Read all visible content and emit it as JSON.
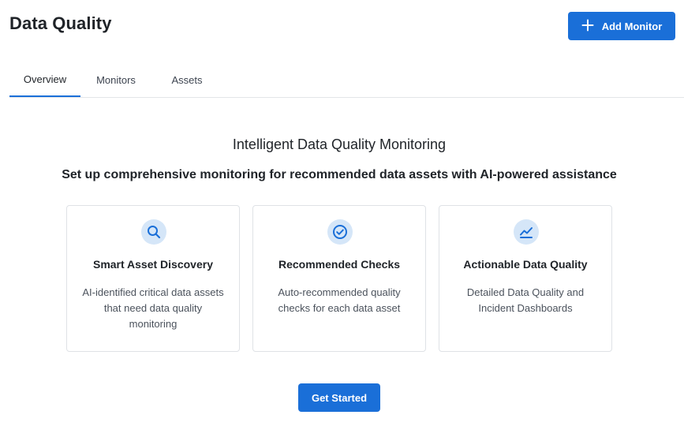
{
  "header": {
    "title": "Data Quality",
    "add_button_label": "Add Monitor",
    "add_button_icon": "plus-icon"
  },
  "tabs": [
    {
      "label": "Overview",
      "active": true
    },
    {
      "label": "Monitors",
      "active": false
    },
    {
      "label": "Assets",
      "active": false
    }
  ],
  "hero": {
    "title": "Intelligent Data Quality Monitoring",
    "subtitle": "Set up comprehensive monitoring for recommended data assets with AI-powered assistance"
  },
  "cards": [
    {
      "icon": "search-icon",
      "title": "Smart Asset Discovery",
      "description": "AI-identified critical data assets that need data quality monitoring"
    },
    {
      "icon": "check-circle-icon",
      "title": "Recommended Checks",
      "description": "Auto-recommended quality checks for each data asset"
    },
    {
      "icon": "trend-chart-icon",
      "title": "Actionable Data Quality",
      "description": "Detailed Data Quality and Incident Dashboards"
    }
  ],
  "cta": {
    "label": "Get Started"
  },
  "colors": {
    "accent": "#1a6fd8",
    "icon_bg": "#d5e6f8",
    "border": "#dfe2e6"
  }
}
